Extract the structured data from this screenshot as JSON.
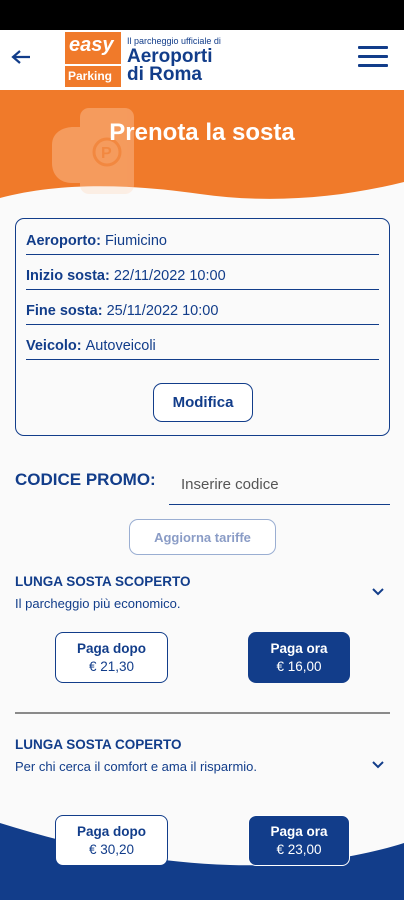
{
  "header": {
    "logo_easy": "easy",
    "logo_parking": "Parking",
    "tagline": "Il parcheggio ufficiale di",
    "brand_line1": "Aeroporti",
    "brand_line2": "di Roma"
  },
  "hero": {
    "title": "Prenota la sosta"
  },
  "summary": {
    "rows": [
      {
        "label": "Aeroporto:",
        "value": "Fiumicino"
      },
      {
        "label": "Inizio sosta:",
        "value": "22/11/2022 10:00"
      },
      {
        "label": "Fine sosta:",
        "value": "25/11/2022 10:00"
      },
      {
        "label": "Veicolo:",
        "value": "Autoveicoli"
      }
    ],
    "edit_label": "Modifica"
  },
  "promo": {
    "label": "CODICE PROMO:",
    "placeholder": "Inserire codice",
    "update_label": "Aggiorna tariffe"
  },
  "offers": [
    {
      "title": "LUNGA SOSTA SCOPERTO",
      "subtitle": "Il parcheggio più economico.",
      "pay_later": {
        "label": "Paga dopo",
        "price": "€ 21,30"
      },
      "pay_now": {
        "label": "Paga ora",
        "price": "€ 16,00"
      }
    },
    {
      "title": "LUNGA SOSTA COPERTO",
      "subtitle": "Per chi cerca il comfort e ama il risparmio.",
      "pay_later": {
        "label": "Paga dopo",
        "price": "€ 30,20"
      },
      "pay_now": {
        "label": "Paga ora",
        "price": "€ 23,00"
      }
    }
  ],
  "colors": {
    "primary": "#123d8a",
    "accent": "#f07a2a"
  }
}
